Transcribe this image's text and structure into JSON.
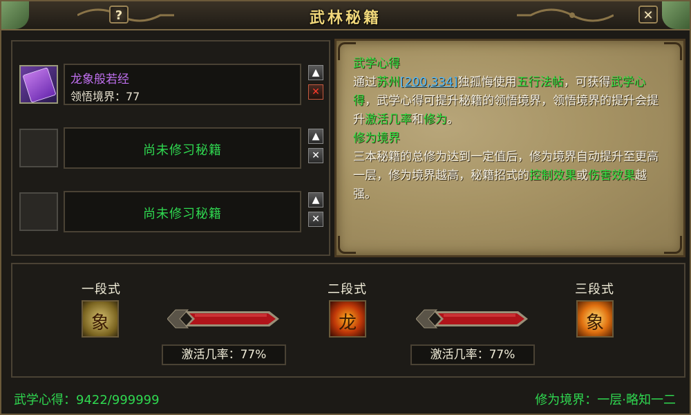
{
  "window": {
    "title": "武林秘籍",
    "help_label": "?",
    "close_label": "✕"
  },
  "books": [
    {
      "name": "龙象般若经",
      "level_label": "领悟境界：77",
      "filled": true,
      "up_label": "▲",
      "remove_label": "✕"
    },
    {
      "empty_label": "尚未修习秘籍",
      "filled": false,
      "up_label": "▲",
      "remove_label": "✕"
    },
    {
      "empty_label": "尚未修习秘籍",
      "filled": false,
      "up_label": "▲",
      "remove_label": "✕"
    }
  ],
  "info": {
    "heading1": "武学心得",
    "p1": {
      "t1": "通过",
      "loc": "苏州",
      "coord": "[200,334]",
      "npc": "独孤悔",
      "t2": "使用",
      "item": "五行法帖",
      "t3": "，可获得",
      "term1": "武学心得",
      "t4": "，武学心得可提升秘籍的领悟境界，领悟境界的提升会提升",
      "term2": "激活几率",
      "t5": "和",
      "term3": "修为",
      "t6": "。"
    },
    "heading2": "修为境界",
    "p2": {
      "t1": "三本秘籍的总修为达到一定值后，修为境界自动提升至更高一层，修为境界越高，秘籍招式的",
      "term1": "控制效果",
      "t2": "或",
      "term2": "伤害效果",
      "t3": "越强。"
    }
  },
  "stages": [
    {
      "label": "一段式",
      "icon": "elephant-skill-icon",
      "glyph": "象"
    },
    {
      "label": "二段式",
      "icon": "dragon-skill-icon",
      "glyph": "龙"
    },
    {
      "label": "三段式",
      "icon": "golden-elephant-skill-icon",
      "glyph": "象"
    }
  ],
  "rates": [
    {
      "label": "激活几率：77%"
    },
    {
      "label": "激活几率：77%"
    }
  ],
  "status": {
    "left": "武学心得：9422/999999",
    "right": "修为境界：一层·略知一二"
  },
  "colors": {
    "title_gold": "#f0d77a",
    "green_text": "#2fd850",
    "purple_book": "#c070f0",
    "link_blue": "#4ab8ff",
    "parchment": "#a69364",
    "arrow_red": "#b0141a"
  }
}
